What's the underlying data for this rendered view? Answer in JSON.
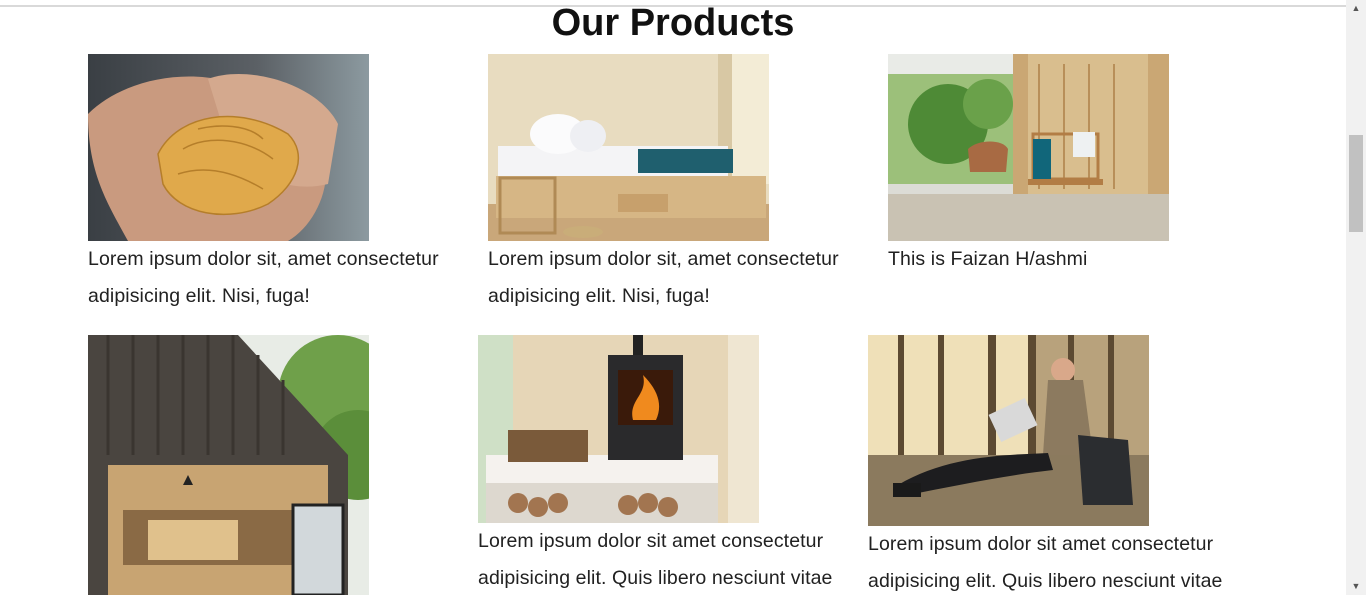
{
  "page": {
    "title": "Our Products"
  },
  "products": [
    {
      "name": "pasta",
      "text": "Lorem ipsum dolor sit, amet consectetur adipisicing elit. Nisi, fuga!"
    },
    {
      "name": "bedroom",
      "text": "Lorem ipsum dolor sit, amet consectetur adipisicing elit. Nisi, fuga!"
    },
    {
      "name": "porch",
      "text": "This is Faizan H/ashmi"
    },
    {
      "name": "cabin",
      "text": ""
    },
    {
      "name": "stove",
      "text": "Lorem ipsum dolor sit amet consectetur adipisicing elit. Quis libero nesciunt vitae"
    },
    {
      "name": "man-laptop",
      "text": "Lorem ipsum dolor sit amet consectetur adipisicing elit. Quis libero nesciunt vitae"
    }
  ],
  "scrollbar": {
    "up_icon": "▲",
    "down_icon": "▼"
  }
}
